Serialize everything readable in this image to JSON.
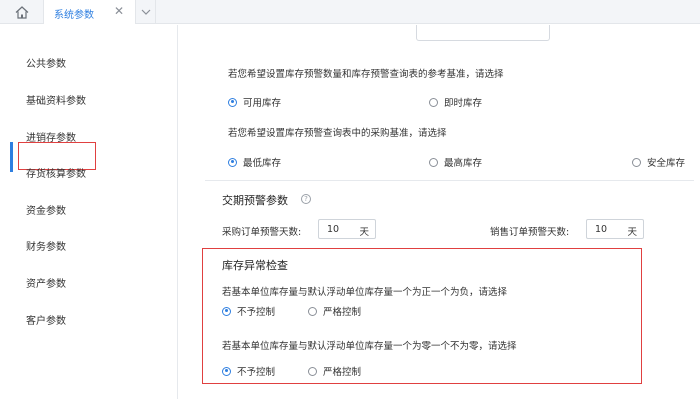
{
  "tabs": {
    "active_label": "系统参数",
    "close_glyph": "✕"
  },
  "sidebar": {
    "items": [
      {
        "label": "公共参数"
      },
      {
        "label": "基础资料参数"
      },
      {
        "label": "进销存参数",
        "active": true
      },
      {
        "label": "存货核算参数"
      },
      {
        "label": "资金参数"
      },
      {
        "label": "财务参数"
      },
      {
        "label": "资产参数"
      },
      {
        "label": "客户参数"
      }
    ]
  },
  "main": {
    "q1": {
      "text": "若您希望设置库存预警数量和库存预警查询表的参考基准，请选择",
      "options": [
        {
          "label": "可用库存",
          "checked": true
        },
        {
          "label": "即时库存",
          "checked": false
        }
      ]
    },
    "q2": {
      "text": "若您希望设置库存预警查询表中的采购基准，请选择",
      "options": [
        {
          "label": "最低库存",
          "checked": true
        },
        {
          "label": "最高库存",
          "checked": false
        },
        {
          "label": "安全库存",
          "checked": false
        }
      ]
    },
    "delivery": {
      "title": "交期预警参数",
      "help_glyph": "?",
      "purchase_label": "采购订单预警天数:",
      "purchase_value": "10",
      "purchase_unit": "天",
      "sales_label": "销售订单预警天数:",
      "sales_value": "10",
      "sales_unit": "天"
    },
    "inventory_check": {
      "title": "库存异常检查",
      "q1_text": "若基本单位库存量与默认浮动单位库存量一个为正一个为负，请选择",
      "q1_options": [
        {
          "label": "不予控制",
          "checked": true
        },
        {
          "label": "严格控制",
          "checked": false
        }
      ],
      "q2_text": "若基本单位库存量与默认浮动单位库存量一个为零一个不为零，请选择",
      "q2_options": [
        {
          "label": "不予控制",
          "checked": true
        },
        {
          "label": "严格控制",
          "checked": false
        }
      ]
    }
  },
  "colors": {
    "accent": "#2f7fe0",
    "highlight": "#e04040"
  }
}
